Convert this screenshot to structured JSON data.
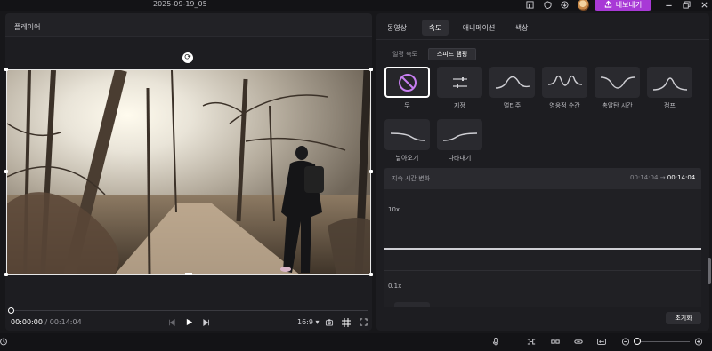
{
  "window": {
    "project_title": "2025-09-19_05",
    "export_label": "내보내기"
  },
  "player": {
    "title": "플레이어",
    "current_time": "00:00:00",
    "separator": "/",
    "duration": "00:14:04",
    "aspect_ratio": "16:9",
    "scrub_progress": 0
  },
  "tabs": [
    {
      "label": "동영상"
    },
    {
      "label": "속도"
    },
    {
      "label": "애니메이션"
    },
    {
      "label": "색상"
    }
  ],
  "subtabs": [
    {
      "label": "일정 속도"
    },
    {
      "label": "스피드 램핑"
    }
  ],
  "presets": [
    {
      "label": "무"
    },
    {
      "label": "지정"
    },
    {
      "label": "멀티주"
    },
    {
      "label": "영웅적 순간"
    },
    {
      "label": "총알탄 시간"
    },
    {
      "label": "점프"
    },
    {
      "label": "날아오기"
    },
    {
      "label": "나타내기"
    }
  ],
  "graph": {
    "title": "지속 시간 변화",
    "from_time": "00:14:04",
    "arrow": "→",
    "to_time": "00:14:04",
    "y_max_label": "10x",
    "y_min_label": "0.1x"
  },
  "reset_label": "초기화",
  "colors": {
    "accent": "#a839d6",
    "none_icon": "#c77ef0"
  },
  "icons": {
    "top": [
      "layout-icon",
      "shield-icon",
      "download-icon",
      "avatar",
      "export-icon",
      "minimize-icon",
      "restore-icon",
      "close-icon"
    ],
    "bottom": [
      "history-icon",
      "microphone-icon",
      "split-icon",
      "link-icon",
      "unlink-icon",
      "fit-icon",
      "zoom-out-icon",
      "zoom-in-icon"
    ]
  }
}
